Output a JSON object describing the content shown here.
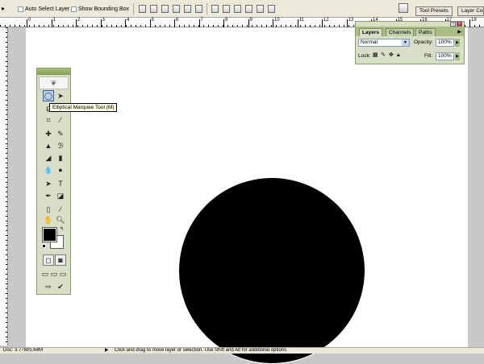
{
  "options_bar": {
    "auto_select_label": "Auto Select Layer",
    "show_bounding_box_label": "Show Bounding Box",
    "well_tab_tool_presets": "Tool Presets",
    "well_tab_layer_comps": "Layer Com"
  },
  "tooltip": {
    "text": "Elliptical Marquee Tool (M)"
  },
  "layers_palette": {
    "tabs": [
      "Layers",
      "Channels",
      "Paths"
    ],
    "blend_mode": "Normal",
    "opacity_label": "Opacity:",
    "opacity_value": "100%",
    "lock_label": "Lock:",
    "fill_label": "Fill:",
    "fill_value": "100%"
  },
  "ruler": {
    "top_numbers": [
      "0",
      "1",
      "2",
      "3",
      "4",
      "5",
      "6",
      "7",
      "8",
      "9",
      "10",
      "11",
      "12",
      "13",
      "14",
      "15",
      "16",
      "17",
      "18"
    ]
  },
  "status_bar": {
    "doc_info": "Doc: 3.77M/5.64M",
    "hint": "Click and drag to move layer or selection.  Use Shift and Alt for additional options."
  },
  "colors": {
    "foreground": "#000000",
    "background": "#ffffff",
    "palette_header": "#a9bd83"
  }
}
